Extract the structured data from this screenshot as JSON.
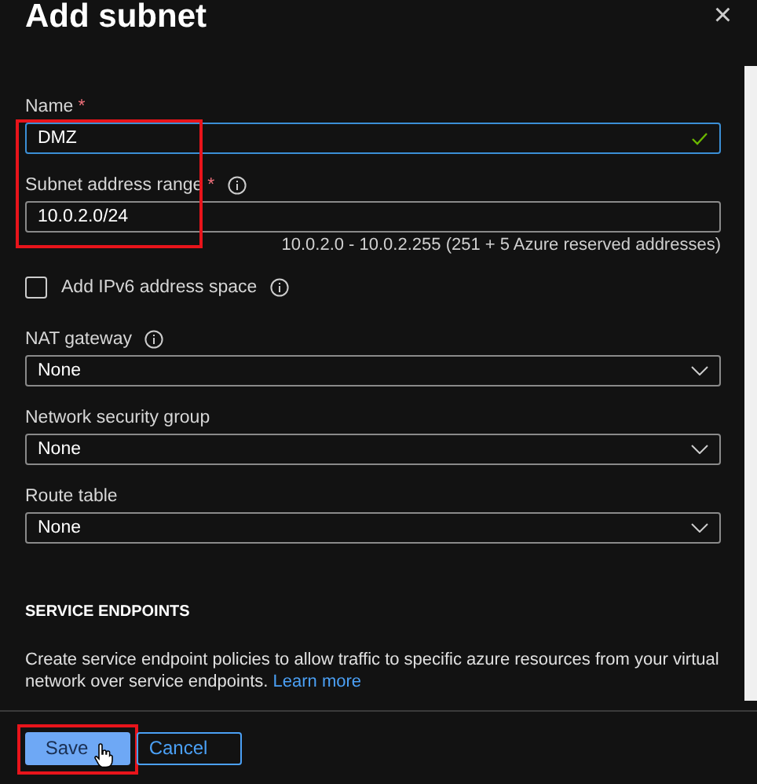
{
  "panel": {
    "title": "Add subnet",
    "close": "×"
  },
  "fields_highlighted": true,
  "fields": [
    {
      "kind": "text",
      "label": "Name",
      "required_mark": "*",
      "value": "DMZ",
      "focused": true,
      "valid": true
    },
    {
      "kind": "text",
      "label": "Subnet address range",
      "required_mark": "*",
      "info": true,
      "value": "10.0.2.0/24",
      "hint": "10.0.2.0 - 10.0.2.255 (251 + 5 Azure reserved addresses)"
    },
    {
      "kind": "checkbox",
      "label": "Add IPv6 address space",
      "info": true,
      "checked": false
    },
    {
      "kind": "select",
      "label": "NAT gateway",
      "info": true,
      "value": "None"
    },
    {
      "kind": "select",
      "label": "Network security group",
      "value": "None"
    },
    {
      "kind": "select",
      "label": "Route table",
      "value": "None"
    }
  ],
  "section": {
    "heading": "SERVICE ENDPOINTS",
    "description": "Create service endpoint policies to allow traffic to specific azure resources from your virtual network over service endpoints.",
    "link": "Learn more"
  },
  "buttons": [
    {
      "label": "Save",
      "kind": "primary",
      "highlighted": true,
      "hovered": true
    },
    {
      "label": "Cancel",
      "kind": "secondary"
    }
  ]
}
